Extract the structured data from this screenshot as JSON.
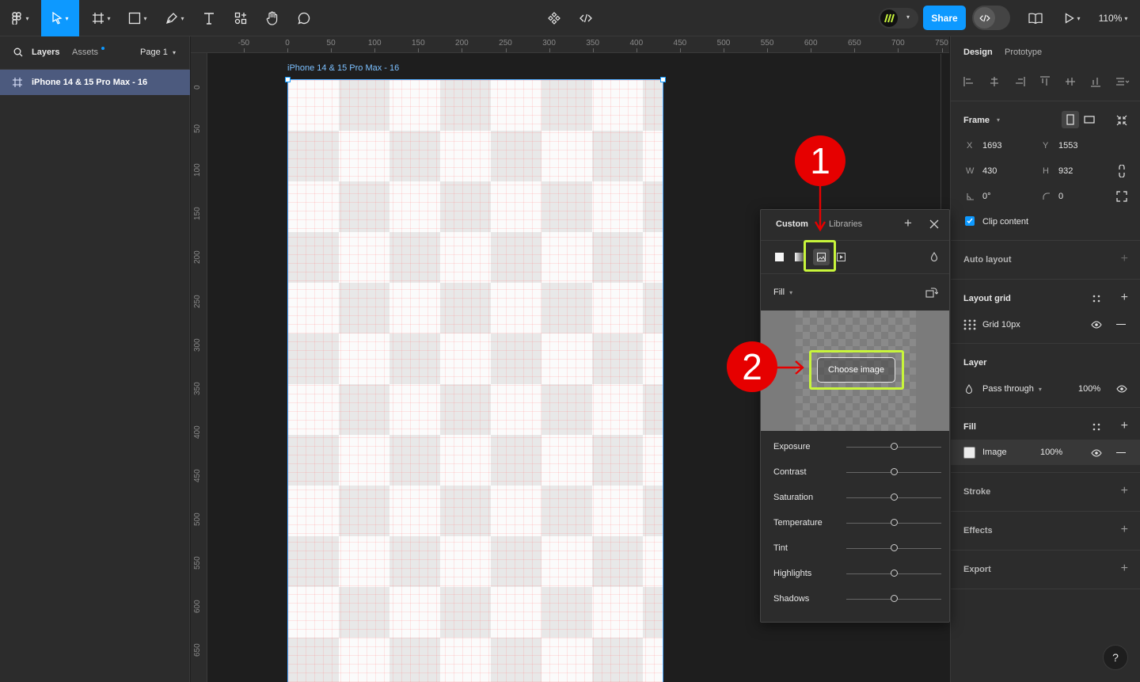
{
  "topbar": {
    "zoom": "110%",
    "share_label": "Share"
  },
  "leftpanel": {
    "tabs": [
      "Layers",
      "Assets"
    ],
    "page_label": "Page 1",
    "layers": [
      {
        "label": "iPhone 14 & 15 Pro Max - 16",
        "selected": true
      }
    ]
  },
  "canvas": {
    "frame_label": "iPhone 14 & 15 Pro Max - 16",
    "ruler_top": [
      "-50",
      "0",
      "50",
      "100",
      "150",
      "200",
      "250",
      "300",
      "350",
      "400",
      "450",
      "500",
      "550",
      "600",
      "650",
      "700",
      "750"
    ],
    "ruler_left": [
      "0",
      "50",
      "100",
      "150",
      "200",
      "250",
      "300",
      "350",
      "400",
      "450",
      "500",
      "550",
      "600",
      "650"
    ]
  },
  "popup": {
    "tabs": [
      "Custom",
      "Libraries"
    ],
    "fill_label": "Fill",
    "choose_image_label": "Choose image",
    "adjustments": [
      {
        "label": "Exposure",
        "value": 0.5
      },
      {
        "label": "Contrast",
        "value": 0.5
      },
      {
        "label": "Saturation",
        "value": 0.5
      },
      {
        "label": "Temperature",
        "value": 0.5
      },
      {
        "label": "Tint",
        "value": 0.5
      },
      {
        "label": "Highlights",
        "value": 0.5
      },
      {
        "label": "Shadows",
        "value": 0.5
      }
    ]
  },
  "annotations": {
    "marker1": "1",
    "marker2": "2",
    "highlight_color": "#c8f53b",
    "marker_color": "#e60000"
  },
  "rightpanel": {
    "tabs": [
      "Design",
      "Prototype"
    ],
    "frame": {
      "title": "Frame",
      "x_label": "X",
      "x": "1693",
      "y_label": "Y",
      "y": "1553",
      "w_label": "W",
      "w": "430",
      "h_label": "H",
      "h": "932",
      "rotation": "0°",
      "radius": "0",
      "clip_label": "Clip content"
    },
    "auto_layout": "Auto layout",
    "layout_grid": {
      "title": "Layout grid",
      "item": "Grid 10px"
    },
    "layer": {
      "title": "Layer",
      "blend": "Pass through",
      "opacity": "100%"
    },
    "fill": {
      "title": "Fill",
      "type": "Image",
      "opacity": "100%"
    },
    "stroke": "Stroke",
    "effects": "Effects",
    "export": "Export",
    "help": "?"
  }
}
